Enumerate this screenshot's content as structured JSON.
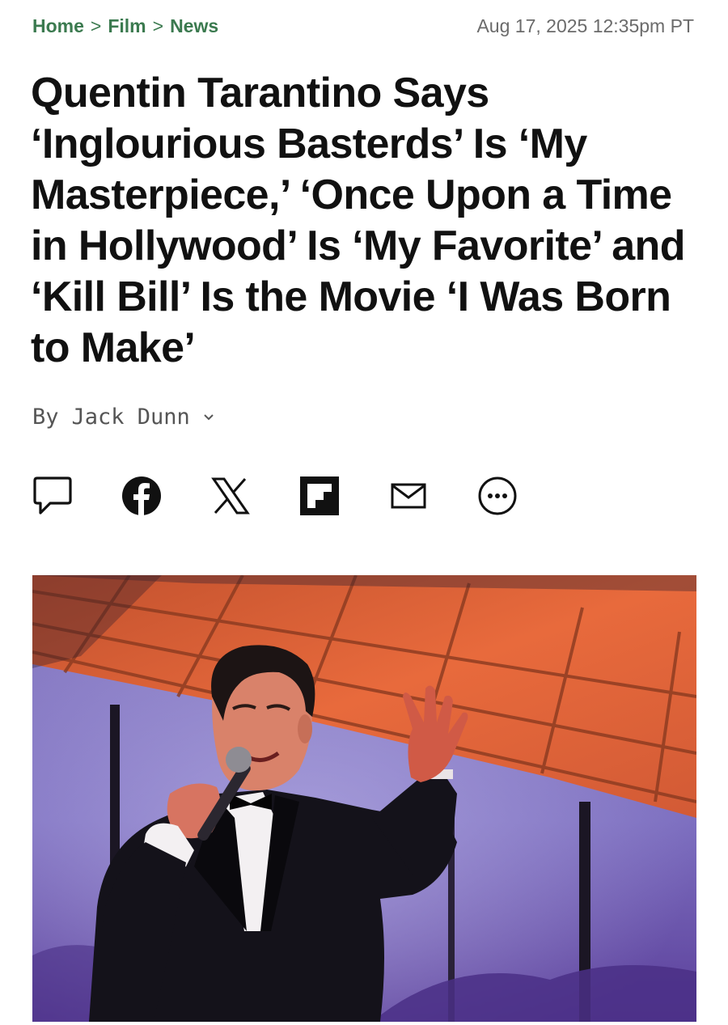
{
  "breadcrumb": {
    "items": [
      {
        "label": "Home"
      },
      {
        "label": "Film"
      },
      {
        "label": "News"
      }
    ],
    "separator": ">"
  },
  "timestamp": "Aug 17, 2025 12:35pm PT",
  "headline": "Quentin Tarantino Says ‘Inglourious Basterds’ Is ‘My Masterpiece,’ ‘Once Upon a Time in Hollywood’ Is ‘My Favorite’ and ‘Kill Bill’ Is the Movie ‘I Was Born to Make’",
  "byline": {
    "prefix": "By",
    "author": "Jack Dunn",
    "dropdown_icon": "chevron-down-icon"
  },
  "share_icons": [
    "comment-icon",
    "facebook-icon",
    "x-icon",
    "flipboard-icon",
    "email-icon",
    "more-icon"
  ],
  "colors": {
    "breadcrumb": "#3b7a4f",
    "timestamp": "#6b6b6b",
    "headline": "#111111",
    "byline": "#555555"
  }
}
